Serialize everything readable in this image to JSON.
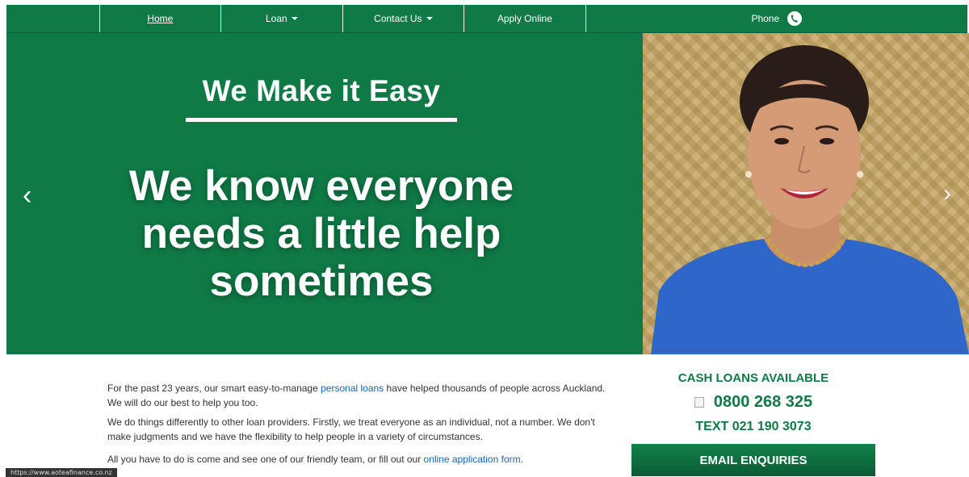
{
  "nav": {
    "items": [
      {
        "label": "Home"
      },
      {
        "label": "Loan"
      },
      {
        "label": "Contact Us"
      },
      {
        "label": "Apply Online"
      },
      {
        "label": "Phone"
      }
    ]
  },
  "hero": {
    "heading": "We Make it Easy",
    "line1": "We know everyone",
    "line2": "needs a little help",
    "line3": "sometimes",
    "prev_arrow": "‹",
    "next_arrow": "›"
  },
  "content": {
    "p1_before": "For the past 23 years, our smart easy-to-manage ",
    "p1_link": "personal loans",
    "p1_after": " have helped thousands of people across Auckland. We will do our best to help you too.",
    "p2": "We do things differently to other loan providers. Firstly, we treat everyone as an individual, not a number. We don't make judgments and we have the flexibility to help people in a variety of circumstances.",
    "p3_before": "All you have to do is come and see one of our friendly team, or fill out our ",
    "p3_link": "online application form",
    "p3_after": "."
  },
  "sidebar": {
    "cash_loans": "CASH LOANS AVAILABLE",
    "phone": "0800 268 325",
    "text": "TEXT 021 190 3073",
    "email_button": "EMAIL ENQUIRIES"
  },
  "statusbar": {
    "url": "https://www.aoteafinance.co.nz"
  },
  "colors": {
    "brand_green": "#0f7a46",
    "link_blue": "#1a63b8"
  }
}
